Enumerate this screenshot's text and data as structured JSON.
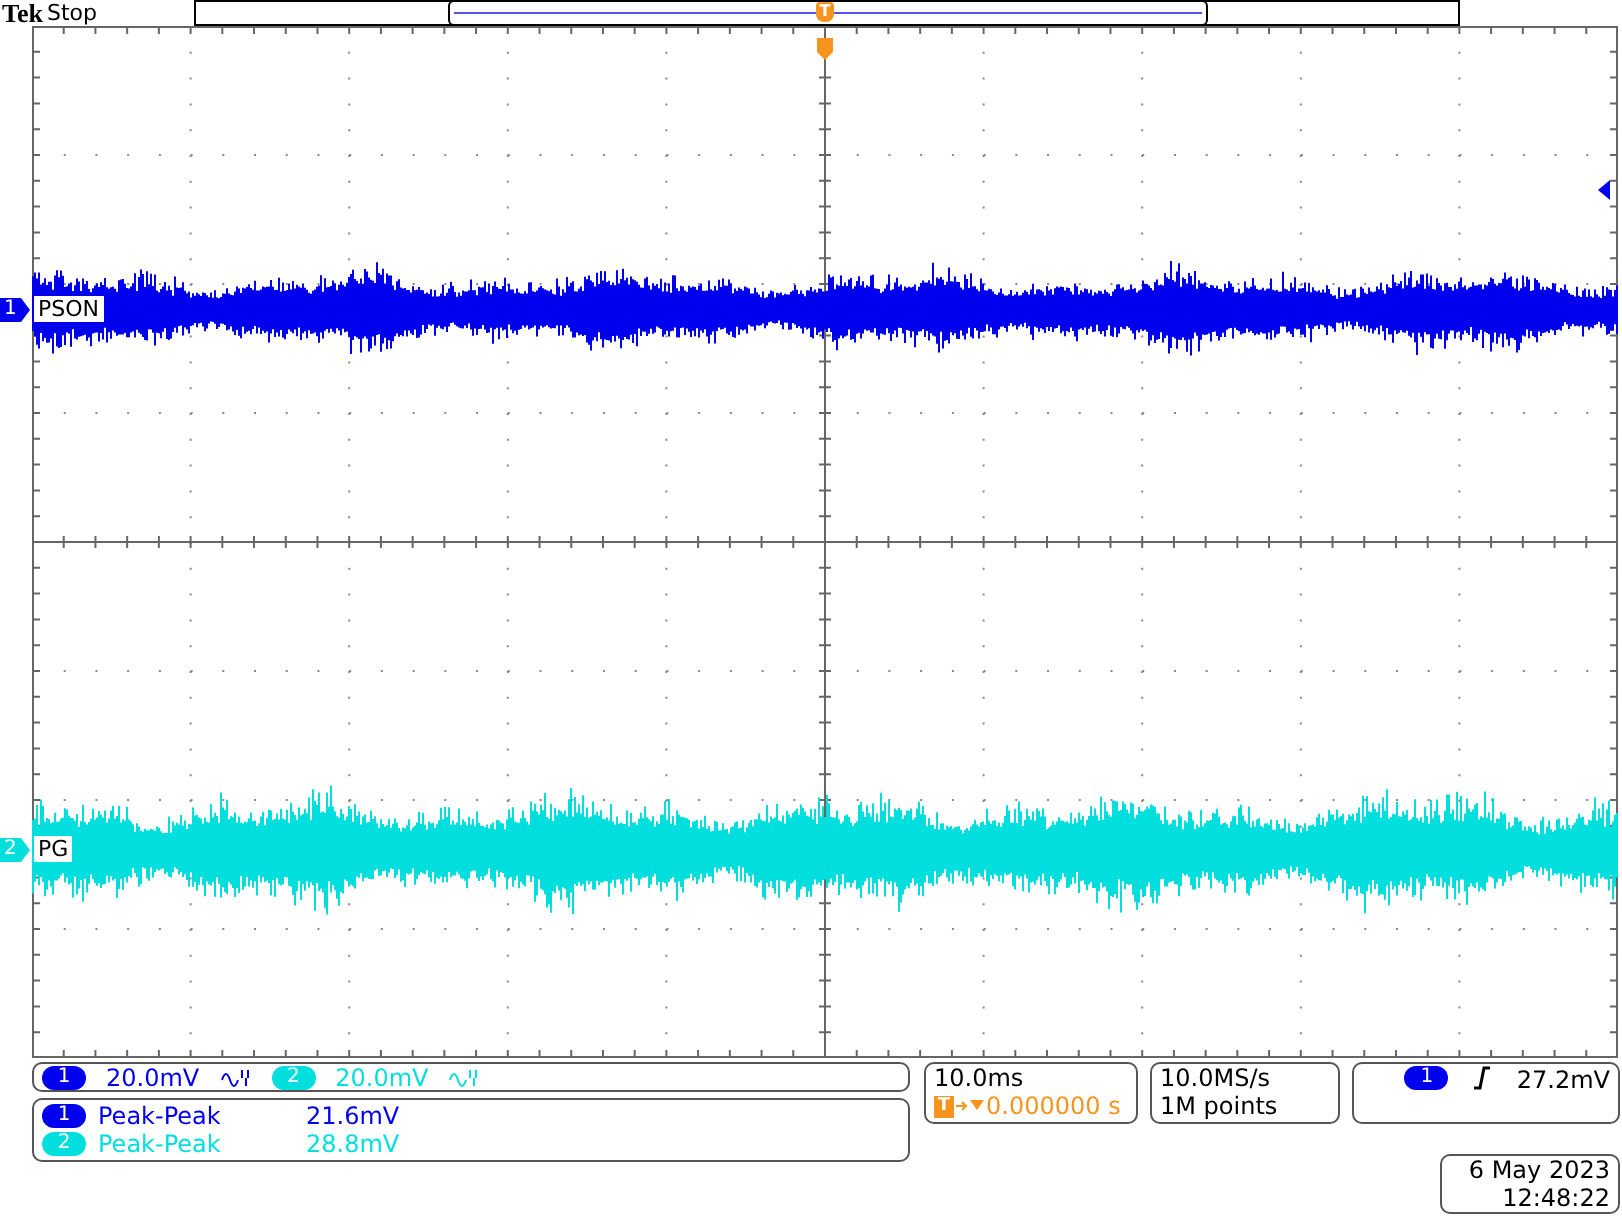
{
  "header": {
    "brand": "Tek",
    "status": "Stop",
    "trigger_marker": "T"
  },
  "channels": [
    {
      "marker": "1",
      "label": "PSON",
      "number": "1",
      "color": "#0000ee",
      "scale": "20.0mV",
      "bandwidth_limited": true
    },
    {
      "marker": "2",
      "label": "PG",
      "number": "2",
      "color": "#00dede",
      "scale": "20.0mV",
      "bandwidth_limited": true
    }
  ],
  "measurements": [
    {
      "channel": "1",
      "name": "Peak-Peak",
      "value": "21.6mV",
      "color": "#0000ee"
    },
    {
      "channel": "2",
      "name": "Peak-Peak",
      "value": "28.8mV",
      "color": "#00dede"
    }
  ],
  "timebase": {
    "scale": "10.0ms",
    "marker": "T",
    "delay": "0.000000 s"
  },
  "acquisition": {
    "sample_rate": "10.0MS/s",
    "record_length": "1M points"
  },
  "trigger": {
    "channel": "1",
    "level": "27.2mV",
    "color": "#0000ee"
  },
  "timestamp": {
    "date": "6 May 2023",
    "time": "12:48:22"
  }
}
